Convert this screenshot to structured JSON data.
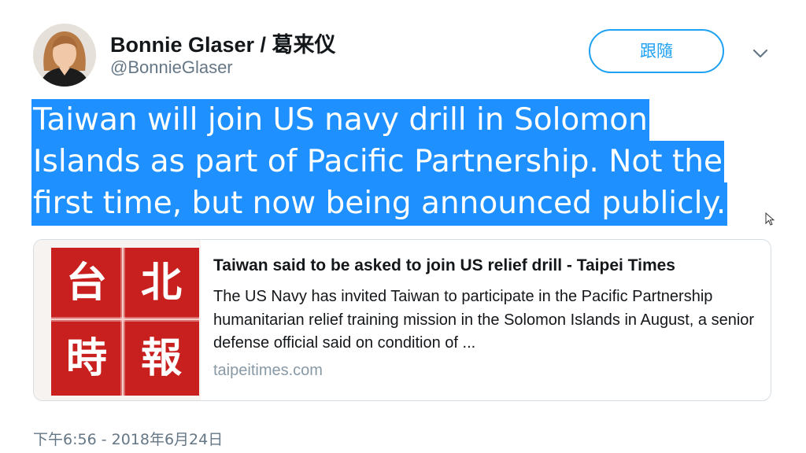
{
  "tweet": {
    "author": {
      "display_name": "Bonnie Glaser / 葛来仪",
      "handle": "@BonnieGlaser",
      "avatar_icon": "profile-photo"
    },
    "follow_label": "跟隨",
    "menu_icon": "chevron-down-icon",
    "text": "Taiwan will join US navy drill in Solomon Islands as part of Pacific Partnership. Not the first time, but now being announced publicly.",
    "text_lines": [
      "Taiwan will join US navy drill in Solomon ",
      "Islands as part of Pacific Partnership. Not the ",
      "first time, but now being announced publicly."
    ],
    "selection_color": "#1e90ff",
    "timestamp": "下午6:56 - 2018年6月24日"
  },
  "card": {
    "title": "Taiwan said to be asked to join US relief drill - Taipei Times",
    "description": "The US Navy has invited Taiwan to participate in the Pacific Partnership humanitarian relief training mission in the Solomon Islands in August, a senior defense official said on condition of ...",
    "domain": "taipeitimes.com",
    "logo_characters": [
      "台",
      "北",
      "時",
      "報"
    ],
    "logo_color": "#c8201e"
  },
  "colors": {
    "accent": "#1da1f2",
    "text": "#14171a",
    "secondary": "#657786"
  }
}
